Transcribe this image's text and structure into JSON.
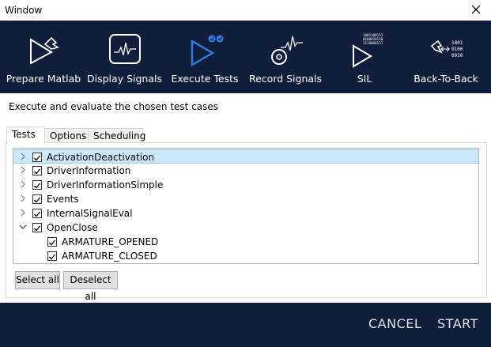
{
  "window": {
    "title": "Window"
  },
  "toolbar": {
    "items": [
      {
        "label": "Prepare Matlab"
      },
      {
        "label": "Display Signals"
      },
      {
        "label": "Execute Tests"
      },
      {
        "label": "Record Signals"
      },
      {
        "label": "SIL",
        "bits": [
          "1001100111",
          "0100010110",
          "1110060111"
        ]
      },
      {
        "label": "Back-To-Back",
        "bits": [
          "1001",
          "0100",
          "0010"
        ]
      }
    ],
    "active_index": 2,
    "active_color": "#2f7fe0"
  },
  "subtitle": "Execute and evaluate the chosen test cases",
  "tabs": [
    {
      "label": "Tests"
    },
    {
      "label": "Options"
    },
    {
      "label": "Scheduling"
    }
  ],
  "tree": {
    "rows": [
      {
        "label": "ActivationDeactivation",
        "checked": true,
        "expander": "collapsed",
        "selected": true
      },
      {
        "label": "DriverInformation",
        "checked": true,
        "expander": "collapsed"
      },
      {
        "label": "DriverInformationSimple",
        "checked": true,
        "expander": "collapsed"
      },
      {
        "label": "Events",
        "checked": true,
        "expander": "collapsed"
      },
      {
        "label": "InternalSignalEval",
        "checked": true,
        "expander": "collapsed"
      },
      {
        "label": "OpenClose",
        "checked": true,
        "expander": "expanded"
      },
      {
        "label": "ARMATURE_OPENED",
        "checked": true,
        "expander": "none"
      },
      {
        "label": "ARMATURE_CLOSED",
        "checked": true,
        "expander": "none"
      }
    ]
  },
  "buttons": {
    "select_all": "Select all",
    "deselect_all": "Deselect all"
  },
  "footer": {
    "cancel": "CANCEL",
    "start": "START"
  },
  "colors": {
    "dark_bg": "#101e3b",
    "selection": "#cce8ff"
  }
}
